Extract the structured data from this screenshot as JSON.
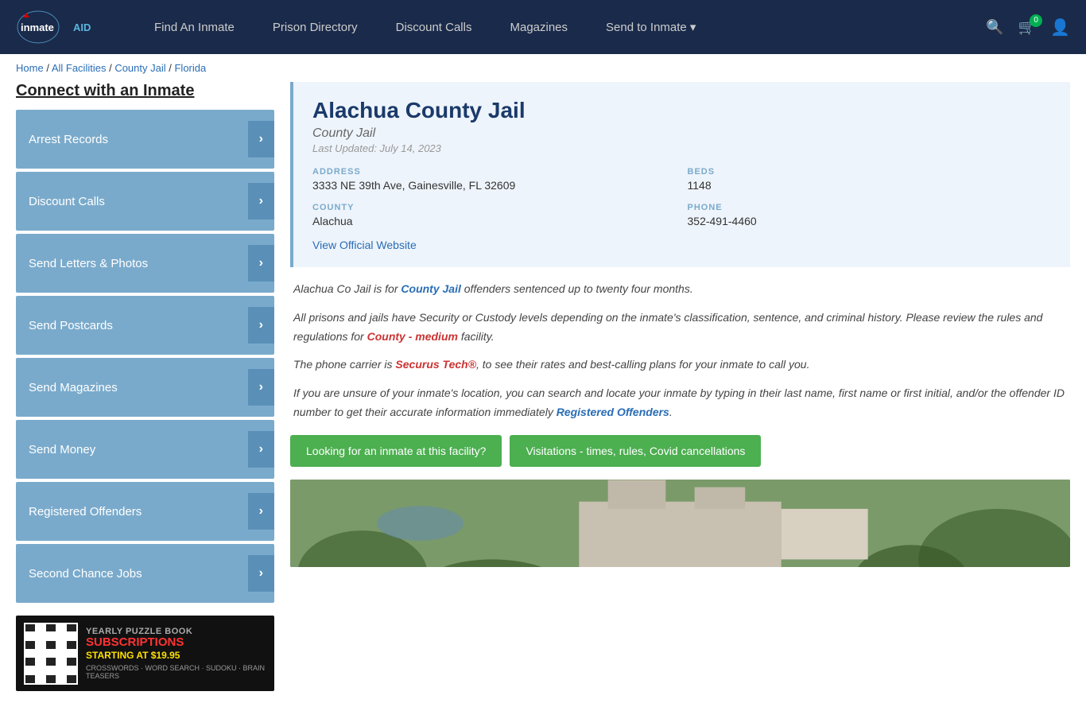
{
  "site": {
    "logo": "inmateAID",
    "logo_part1": "inmate",
    "logo_part2": "AID"
  },
  "nav": {
    "links": [
      {
        "label": "Find An Inmate",
        "id": "find-inmate"
      },
      {
        "label": "Prison Directory",
        "id": "prison-directory"
      },
      {
        "label": "Discount Calls",
        "id": "discount-calls"
      },
      {
        "label": "Magazines",
        "id": "magazines"
      },
      {
        "label": "Send to Inmate ▾",
        "id": "send-to-inmate"
      }
    ],
    "cart_count": "0"
  },
  "breadcrumb": {
    "home": "Home",
    "all_facilities": "All Facilities",
    "county_jail": "County Jail",
    "state": "Florida",
    "separator": " / "
  },
  "sidebar": {
    "title": "Connect with an Inmate",
    "items": [
      {
        "label": "Arrest Records",
        "id": "arrest-records"
      },
      {
        "label": "Discount Calls",
        "id": "discount-calls"
      },
      {
        "label": "Send Letters & Photos",
        "id": "send-letters"
      },
      {
        "label": "Send Postcards",
        "id": "send-postcards"
      },
      {
        "label": "Send Magazines",
        "id": "send-magazines"
      },
      {
        "label": "Send Money",
        "id": "send-money"
      },
      {
        "label": "Registered Offenders",
        "id": "registered-offenders"
      },
      {
        "label": "Second Chance Jobs",
        "id": "second-chance-jobs"
      }
    ],
    "ad": {
      "line1": "YEARLY PUZZLE BOOK",
      "line2": "SUBSCRIPTIONS",
      "line3": "STARTING AT $19.95",
      "line4": "CROSSWORDS · WORD SEARCH · SUDOKU · BRAIN TEASERS"
    }
  },
  "facility": {
    "name": "Alachua County Jail",
    "type": "County Jail",
    "last_updated": "Last Updated: July 14, 2023",
    "address_label": "ADDRESS",
    "address_value": "3333 NE 39th Ave, Gainesville, FL 32609",
    "beds_label": "BEDS",
    "beds_value": "1148",
    "county_label": "COUNTY",
    "county_value": "Alachua",
    "phone_label": "PHONE",
    "phone_value": "352-491-4460",
    "website_link": "View Official Website",
    "description1": "Alachua Co Jail is for County Jail offenders sentenced up to twenty four months.",
    "description2": "All prisons and jails have Security or Custody levels depending on the inmate's classification, sentence, and criminal history. Please review the rules and regulations for County - medium facility.",
    "description3": "The phone carrier is Securus Tech®, to see their rates and best-calling plans for your inmate to call you.",
    "description4": "If you are unsure of your inmate's location, you can search and locate your inmate by typing in their last name, first name or first initial, and/or the offender ID number to get their accurate information immediately Registered Offenders.",
    "btn_looking": "Looking for an inmate at this facility?",
    "btn_visitations": "Visitations - times, rules, Covid cancellations"
  }
}
